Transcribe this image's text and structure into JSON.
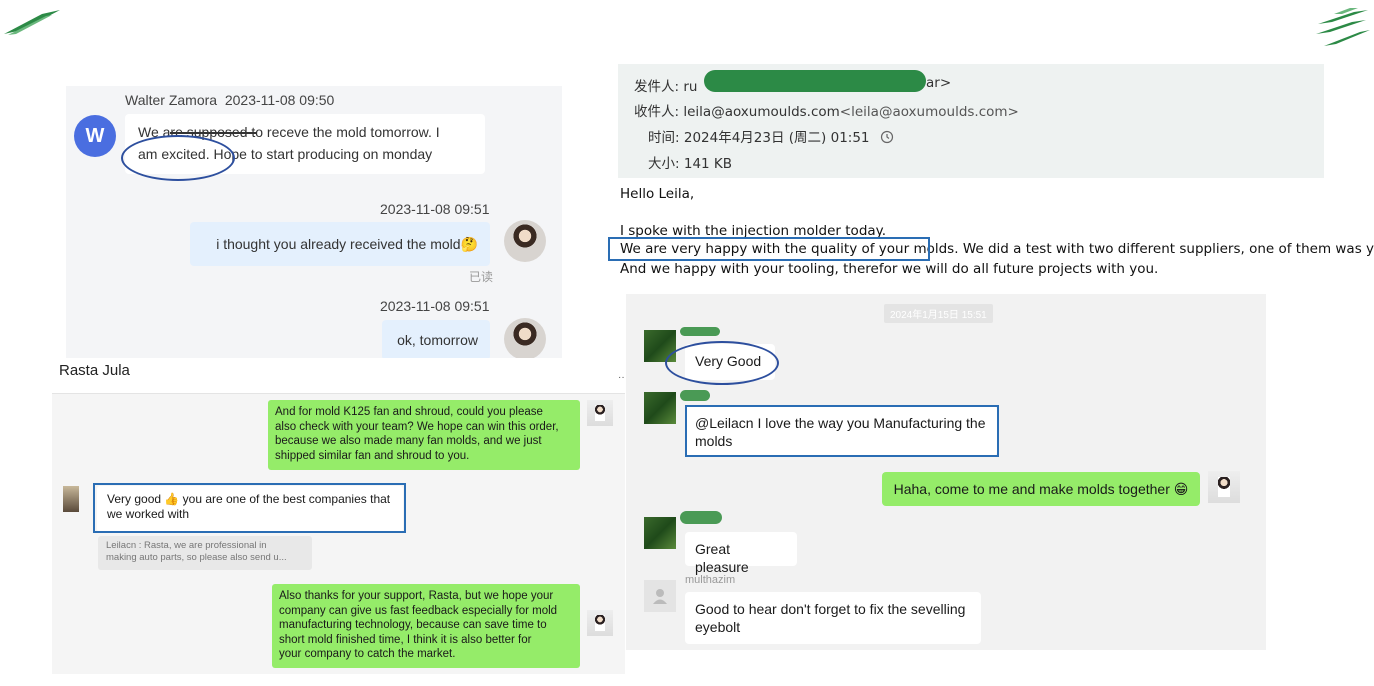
{
  "colors": {
    "accent_green": "#2c8a46",
    "highlight_blue": "#2d4f9e",
    "wechat_green": "#95ec69"
  },
  "logos": {
    "left": "green-stripe-logo",
    "right": "green-stripe-logo"
  },
  "walter_chat": {
    "sender_name": "Walter Zamora",
    "sender_time": "2023-11-08 09:50",
    "avatar_letter": "W",
    "incoming_message": "We are supposed to receve the mold tomorrow. I am excited. Hope to start producing on monday",
    "incoming_line1": "We are supposed to receve the mold tomorrow. I",
    "incoming_line2": "am excited. Hope to start producing on monday",
    "reply1_time": "2023-11-08 09:51",
    "reply1_text": "i thought you already received the mold",
    "reply1_emoji": "🤔",
    "read_status": "已读",
    "reply2_time": "2023-11-08 09:51",
    "reply2_text": "ok, tomorrow"
  },
  "email": {
    "from_label": "发件人:",
    "from_value_start": "ru",
    "from_value_end": "ar>",
    "to_label": "收件人:",
    "to_value": "leila@aoxumoulds.com",
    "to_value_gray": "<leila@aoxumoulds.com>",
    "time_label": "时间:",
    "time_value": "2024年4月23日 (周二) 01:51",
    "size_label": "大小:",
    "size_value": "141 KB",
    "greeting": "Hello Leila,",
    "line1": "I spoke with the injection molder today.",
    "line2_highlight": "We are very happy with the quality of your molds.",
    "line2_rest": "We did a test with two different suppliers, one of them was you.",
    "line3": "And we happy with your tooling, therefor we will do all future projects with you."
  },
  "rasta_chat": {
    "title": "Rasta Jula",
    "msg1": "And for mold K125 fan and shroud, could you please also check with your team? We hope can win this order, because we also made many fan molds, and we just shipped similar fan and shroud to you.",
    "msg1_lines": [
      "And for mold K125 fan and shroud, could you please",
      "also check with your team? We hope can win this order,",
      "because we also made many fan molds, and we just",
      "shipped similar fan and shroud to you."
    ],
    "reply_line1": "Very good 👍 you are one of the best companies that",
    "reply_line2": "we worked with",
    "quote_line1": "Leilacn : Rasta, we are professional in",
    "quote_line2": "making auto parts, so please also send u...",
    "msg2_lines": [
      "Also thanks for your support, Rasta, but we hope your",
      "company can give us fast feedback especially for mold",
      "manufacturing technology, because can save time to",
      "short mold finished time, I think it is also better for",
      "your company to catch the market."
    ]
  },
  "group_chat": {
    "date": "2024年1月15日 15:51",
    "msg1": "Very Good",
    "msg2_line1": "@Leilacn I love the way you Manufacturing the",
    "msg2_line2": "molds",
    "own_msg": "Haha, come to me and make molds together",
    "own_emoji": "😁",
    "msg3": "Great pleasure",
    "sender4": "multhazim",
    "msg4_line1": "Good to hear don't forget to fix the sevelling",
    "msg4_line2": "eyebolt"
  }
}
